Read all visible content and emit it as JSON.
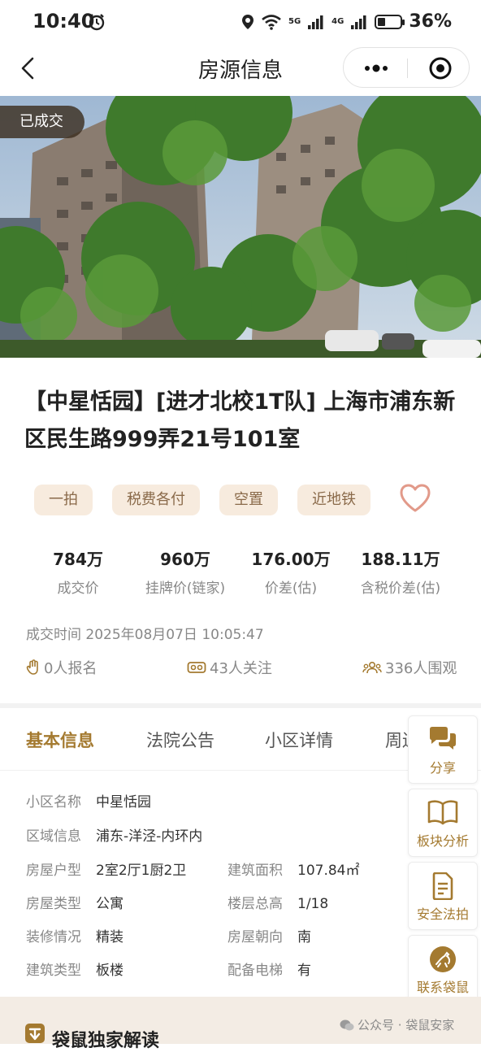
{
  "status_bar": {
    "time": "10:40",
    "net1": "5G",
    "net2": "4G",
    "battery_pct": "36%",
    "battery_level": 0.36
  },
  "nav": {
    "title": "房源信息",
    "back_icon": "chevron-left-icon",
    "more_icon": "more-dots-icon",
    "target_icon": "target-icon"
  },
  "hero": {
    "badge": "已成交"
  },
  "house": {
    "title": "【中星恬园】[进才北校1T队] 上海市浦东新区民生路999弄21号101室",
    "tags": [
      "一拍",
      "税费各付",
      "空置",
      "近地铁"
    ]
  },
  "stats": [
    {
      "value": "784万",
      "label": "成交价"
    },
    {
      "value": "960万",
      "label": "挂牌价(链家)"
    },
    {
      "value": "176.00万",
      "label": "价差(估)"
    },
    {
      "value": "188.11万",
      "label": "含税价差(估)"
    }
  ],
  "deal_time": "成交时间 2025年08月07日 10:05:47",
  "counters": {
    "signup": "0人报名",
    "follow": "43人关注",
    "watch": "336人围观"
  },
  "tabs": [
    "基本信息",
    "法院公告",
    "小区详情",
    "周边"
  ],
  "info": {
    "community_label": "小区名称",
    "community": "中星恬园",
    "area_label": "区域信息",
    "area": "浦东-洋泾-内环内",
    "layout_label": "房屋户型",
    "layout": "2室2厅1厨2卫",
    "size_label": "建筑面积",
    "size": "107.84㎡",
    "type_label": "房屋类型",
    "type": "公寓",
    "floor_label": "楼层总高",
    "floor": "1/18",
    "decor_label": "装修情况",
    "decor": "精装",
    "orient_label": "房屋朝向",
    "orient": "南",
    "build_label": "建筑类型",
    "build": "板楼",
    "elevator_label": "配备电梯",
    "elevator": "有"
  },
  "side_actions": [
    {
      "label": "分享",
      "icon": "chat-bubbles-icon"
    },
    {
      "label": "板块分析",
      "icon": "book-icon"
    },
    {
      "label": "安全法拍",
      "icon": "document-icon"
    },
    {
      "label": "联系袋鼠",
      "icon": "kangaroo-icon"
    }
  ],
  "bottom": {
    "title": "袋鼠独家解读",
    "watermark": "公众号 · 袋鼠安家"
  },
  "colors": {
    "accent": "#a47a30",
    "tag_bg": "#f7ebde",
    "tag_text": "#8a6a4a",
    "heart": "#e29a8a"
  }
}
